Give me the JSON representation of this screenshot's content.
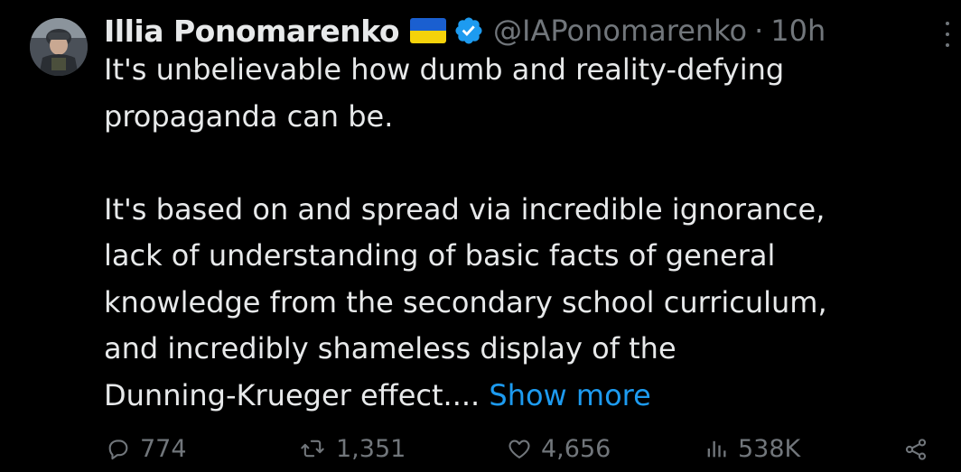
{
  "author": {
    "name": "Illia Ponomarenko",
    "handle": "@IAPonomarenko",
    "separator": "·",
    "time": "10h",
    "flag_colors": [
      "#1a5fd0",
      "#f5d20a"
    ],
    "verified_color": "#1d9bf0"
  },
  "tweet": {
    "lines": [
      "It's unbelievable how dumb and reality-defying",
      "propaganda can be.",
      "",
      "It's based on and spread via incredible ignorance,",
      "lack of understanding of basic facts of general",
      "knowledge from the secondary school curriculum,",
      "and incredibly shameless display of the"
    ],
    "last_line": "Dunning-Krueger effect.... ",
    "show_more": "Show more"
  },
  "actions": {
    "replies": "774",
    "retweets": "1,351",
    "likes": "4,656",
    "views": "538K",
    "icons": [
      "reply-icon",
      "retweet-icon",
      "like-icon",
      "views-icon",
      "share-icon"
    ]
  },
  "colors": {
    "background": "#000000",
    "text": "#e7e9ea",
    "muted": "#71767b",
    "link": "#1d9bf0"
  }
}
